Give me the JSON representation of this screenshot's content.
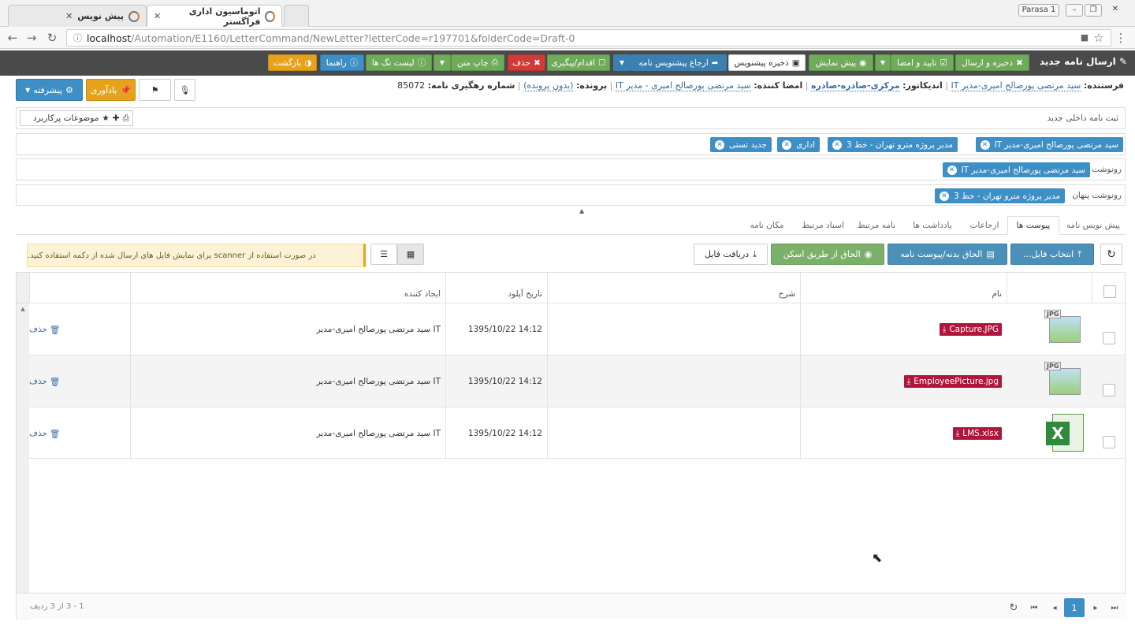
{
  "browser": {
    "tabs": [
      {
        "title": "اتوماسیون اداری فراگستر"
      },
      {
        "title": "پیش نویس"
      }
    ],
    "window_user": "Parasa 1",
    "url_host": "localhost",
    "url_path": "/Automation/E1160/LetterCommand/NewLetter?letterCode=r197701&folderCode=Draft-0"
  },
  "toolbar": {
    "title": "ارسال نامه جدید",
    "save_send": "ذخیره و ارسال",
    "confirm_sign": "تایید و امضا",
    "preview": "پیش نمایش",
    "save_draft": "ذخیره پیشنویس",
    "refer_draft": "ارجاع پیشنویس نامه",
    "action_followup": "اقدام/پیگیری",
    "delete": "حذف",
    "print_text": "چاپ متن",
    "tag_list": "لیست تگ ها",
    "help": "راهنما",
    "back": "بازگشت"
  },
  "side_buttons": {
    "advanced": "پیشرفته",
    "reminder": "یادآوری"
  },
  "info": {
    "sender_label": "فرستنده:",
    "sender_value": "سید مرتضی پورصالح امیری-مدیر IT",
    "indicator_label": "اندیکاتور:",
    "indicator_value": "مرکزی-صادره-صادره",
    "signer_label": "امضا کننده:",
    "signer_value": "سید مرتضی پورصالح امیری - مدیر IT",
    "file_label": "پرونده:",
    "file_value": "(بدون پرونده)",
    "tracking_label": "شماره رهگیری نامه:",
    "tracking_value": "85072"
  },
  "subject_row": {
    "label": "ثبت نامه داخلی جدید",
    "frequent_topics": "موضوعات پرکاربرد"
  },
  "recipients": {
    "to": [
      "سید مرتضی پورصالح امیری-مدیر IT",
      "مدیر پروژه مترو تهران - خط 3",
      "اداری",
      "جدید تستی"
    ],
    "cc_label": "رونوشت",
    "cc": [
      "سید مرتضی پورصالح امیری-مدیر IT"
    ],
    "bcc_label": "رونوشت پنهان",
    "bcc": [
      "مدیر پروژه مترو تهران - خط 3"
    ]
  },
  "tabs": [
    "پیش نویس نامه",
    "پیوست ها",
    "ارجاعات",
    "یادداشت ها",
    "نامه مرتبط",
    "اسناد مرتبط",
    "مکان نامه"
  ],
  "actions": {
    "choose_file": "انتخاب فایل...",
    "attach_letter": "الحاق بدنه/پیوست نامه",
    "attach_scan": "الحاق از طریق اسکن",
    "download_file": "دریافت فایل",
    "scanner_note": "در صورت استفاده از scanner برای نمایش فایل های ارسال شده از دکمه استفاده کنید."
  },
  "table": {
    "headers": {
      "name": "نام",
      "description": "شرح",
      "upload_date": "تاریخ آپلود",
      "creator": "ایجاد کننده"
    },
    "rows": [
      {
        "file": "Capture.JPG",
        "type": "jpg",
        "date": "1395/10/22 14:12",
        "creator": "سید مرتضی پورصالح امیری-مدیر IT",
        "delete": "حذف"
      },
      {
        "file": "EmployeePicture.jpg",
        "type": "jpg",
        "date": "1395/10/22 14:12",
        "creator": "سید مرتضی پورصالح امیری-مدیر IT",
        "delete": "حذف"
      },
      {
        "file": "LMS.xlsx",
        "type": "xlsx",
        "date": "1395/10/22 14:12",
        "creator": "سید مرتضی پورصالح امیری-مدیر IT",
        "delete": "حذف"
      }
    ]
  },
  "pager": {
    "current": "1",
    "summary": "1 - 3 از 3 ردیف"
  }
}
